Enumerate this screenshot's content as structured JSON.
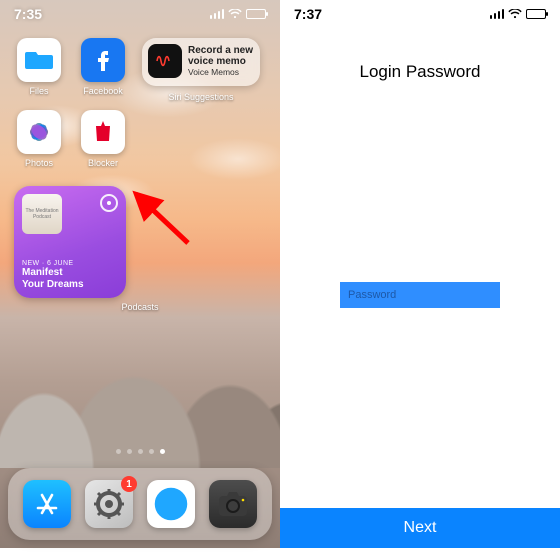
{
  "left": {
    "status_time": "7:35",
    "apps": {
      "files": "Files",
      "facebook": "Facebook",
      "photos": "Photos",
      "blocker": "Blocker"
    },
    "siri": {
      "line1": "Record a new",
      "line2": "voice memo",
      "sub": "Voice Memos",
      "caption": "Siri Suggestions"
    },
    "podcast": {
      "art_text": "The Meditation Podcast",
      "meta": "NEW · 6 JUNE",
      "title": "Manifest\nYour Dreams",
      "caption": "Podcasts"
    },
    "dock_badge": "1"
  },
  "right": {
    "status_time": "7:37",
    "title": "Login Password",
    "placeholder": "Password",
    "next": "Next"
  },
  "colors": {
    "ios_blue": "#0a84ff",
    "field_blue": "#2f8eff",
    "badge_red": "#ff3b30"
  }
}
